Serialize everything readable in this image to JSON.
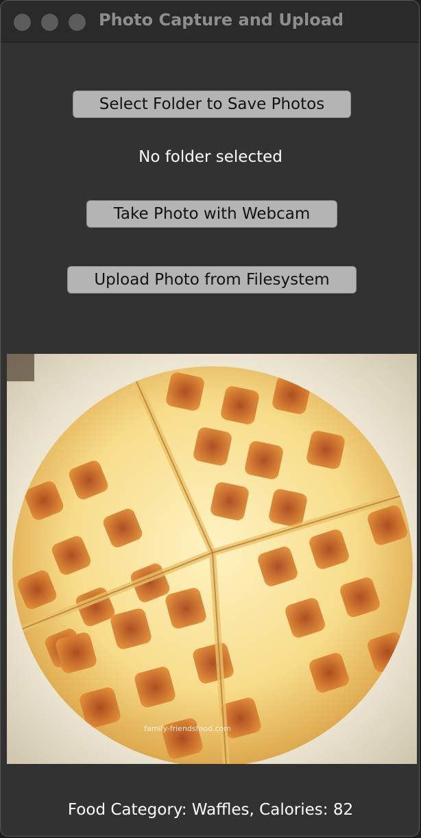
{
  "window": {
    "title": "Photo Capture and Upload"
  },
  "buttons": {
    "select_folder": "Select Folder to Save Photos",
    "take_photo": "Take Photo with Webcam",
    "upload_photo": "Upload Photo from Filesystem"
  },
  "status": {
    "folder": "No folder selected"
  },
  "photo": {
    "subject": "waffles on a plate",
    "watermark": "family-friendsfood.com"
  },
  "result": {
    "text": "Food Category: Waffles, Calories: 82"
  },
  "colors": {
    "window_bg": "#323232",
    "titlebar_bg": "#2a2a2a",
    "button_bg": "#b4b4b4",
    "text_light": "#ffffff"
  }
}
